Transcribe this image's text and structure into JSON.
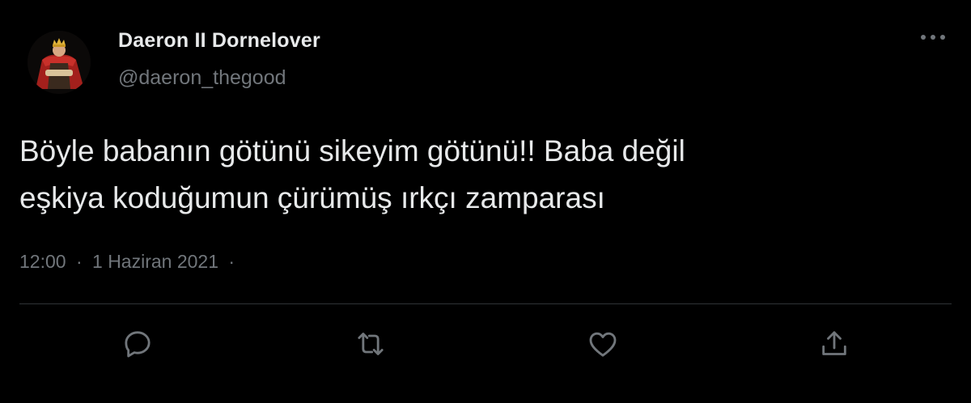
{
  "author": {
    "display_name": "Daeron II Dornelover",
    "handle": "@daeron_thegood",
    "avatar": "avatar-king-red-cloak"
  },
  "tweet": {
    "text": "Böyle babanın götünü sikeyim götünü!! Baba değil\neşkiya koduğumun çürümüş ırkçı zamparası"
  },
  "meta": {
    "time": "12:00",
    "separator": "·",
    "date": "1 Haziran 2021",
    "trailing_separator": "·"
  },
  "actions": {
    "icons": [
      "reply-icon",
      "retweet-icon",
      "like-icon",
      "share-icon"
    ]
  },
  "menu": {
    "icon": "more-icon"
  },
  "colors": {
    "background": "#000000",
    "text_primary": "#e7e9ea",
    "text_secondary": "#71767b",
    "divider": "#2f3336"
  }
}
